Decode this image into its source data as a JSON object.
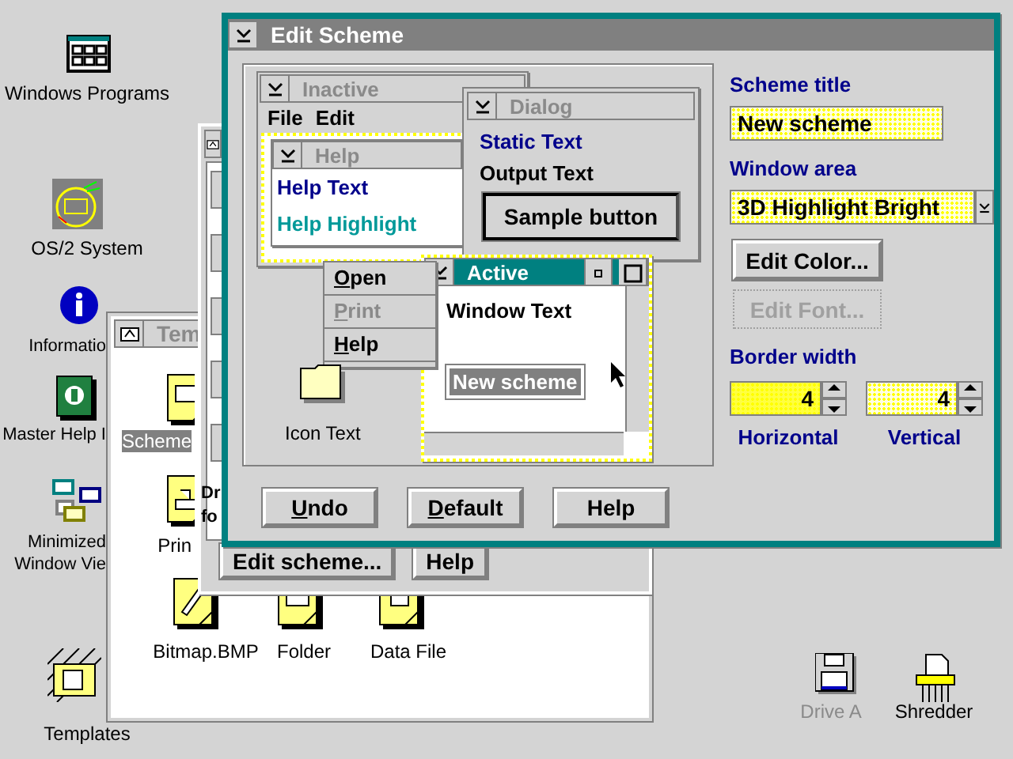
{
  "desktop_icons": [
    {
      "kind": "grid",
      "lines": [
        "Windows Programs"
      ]
    },
    {
      "kind": "os2",
      "lines": [
        "OS/2 System"
      ]
    },
    {
      "kind": "info",
      "lines": [
        "Informatio"
      ]
    },
    {
      "kind": "helpbook",
      "lines": [
        "Master Help I"
      ]
    },
    {
      "kind": "minimized",
      "lines": [
        "Minimized",
        "Window Vie"
      ]
    },
    {
      "kind": "templates",
      "lines": [
        "Templates"
      ]
    },
    {
      "kind": "drive",
      "lines": [
        "Drive A"
      ],
      "disabled": true
    },
    {
      "kind": "shredder",
      "lines": [
        "Shredder"
      ],
      "disabled": false
    }
  ],
  "templates_window": {
    "title": "Tem",
    "items": [
      {
        "kind": "scheme",
        "label": "Scheme",
        "selected": true
      },
      {
        "kind": "printer",
        "label": "Prin",
        "selected": false
      },
      {
        "kind": "bitmap",
        "label": "Bitmap.BMP",
        "selected": false
      },
      {
        "kind": "folder",
        "label": "Folder",
        "selected": false
      },
      {
        "kind": "datafile",
        "label": "Data File",
        "selected": false
      }
    ]
  },
  "palette_window": {
    "text_lines": [
      "Dr",
      "fo"
    ],
    "buttons": [
      "Edit scheme...",
      "Help"
    ]
  },
  "edit_scheme": {
    "title": "Edit Scheme",
    "preview": {
      "inactive_title": "Inactive",
      "menu": [
        "File",
        "Edit"
      ],
      "help_title": "Help",
      "help_text": "Help Text",
      "help_highlight": "Help Highlight",
      "dialog_title": "Dialog",
      "static_text": "Static Text",
      "output_text": "Output Text",
      "sample_button": "Sample button",
      "popup_menu": [
        {
          "label": "Open",
          "disabled": false,
          "mnemonic": true
        },
        {
          "label": "Print",
          "disabled": true,
          "mnemonic": true
        },
        {
          "label": "Help",
          "disabled": false,
          "mnemonic": true
        }
      ],
      "icon_text": "Icon Text",
      "active_title": "Active",
      "window_text": "Window Text",
      "selected_text": "New scheme"
    },
    "buttons": [
      {
        "label": "Undo",
        "mnemonic": true
      },
      {
        "label": "Default",
        "mnemonic": true
      },
      {
        "label": "Help",
        "mnemonic": false
      }
    ],
    "scheme_title_label": "Scheme title",
    "scheme_title": "New scheme",
    "window_area_label": "Window area",
    "window_area": "3D Highlight Bright",
    "edit_buttons": [
      {
        "label": "Edit Color...",
        "disabled": false
      },
      {
        "label": "Edit Font...",
        "disabled": true
      }
    ],
    "border_width_label": "Border width",
    "spinners": [
      {
        "value": "4",
        "label": "Horizontal",
        "selected": true
      },
      {
        "value": "4",
        "label": "Vertical",
        "selected": false
      }
    ]
  }
}
